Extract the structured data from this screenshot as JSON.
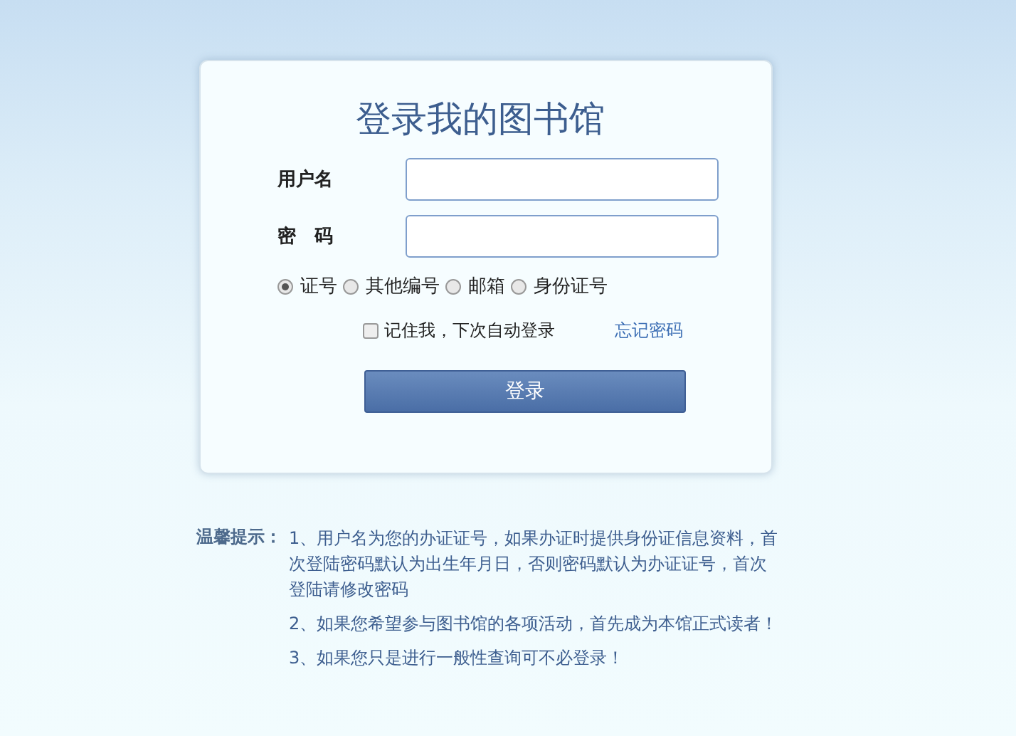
{
  "login_card": {
    "title": "登录我的图书馆",
    "fields": [
      {
        "label": "用户名"
      },
      {
        "label": "密　码"
      }
    ],
    "id_types": [
      {
        "label": "证号",
        "selected": true
      },
      {
        "label": "其他编号",
        "selected": false
      },
      {
        "label": "邮箱",
        "selected": false
      },
      {
        "label": "身份证号",
        "selected": false
      }
    ],
    "remember_me": {
      "label": "记住我，下次自动登录",
      "checked": false
    },
    "forgot_password": "忘记密码",
    "submit": "登录"
  },
  "tips": {
    "heading": "温馨提示：",
    "items": [
      "1、用户名为您的办证证号，如果办证时提供身份证信息资料，首次登陆密码默认为出生年月日，否则密码默认为办证证号，首次登陆请修改密码",
      "2、如果您希望参与图书馆的各项活动，首先成为本馆正式读者！",
      "3、如果您只是进行一般性查询可不必登录！"
    ]
  }
}
